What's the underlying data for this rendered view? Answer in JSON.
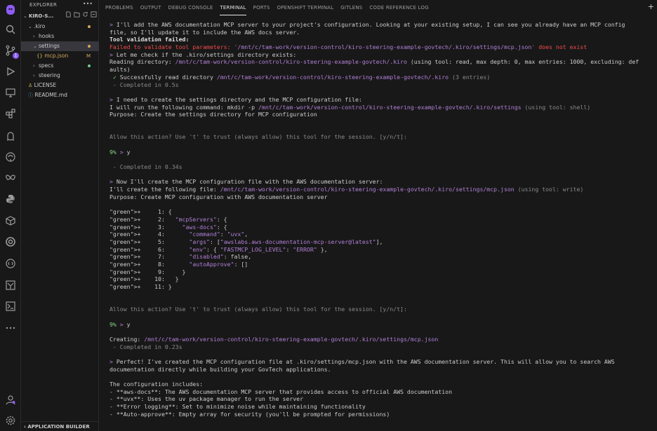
{
  "activity_bar": {
    "icons": [
      "kiro-logo-icon",
      "search-icon",
      "source-control-icon",
      "run-debug-icon",
      "remote-explorer-icon",
      "extensions-icon",
      "kiro-ghost-icon",
      "github-icon",
      "kiro-butterfly-icon",
      "python-icon",
      "containers-icon",
      "openshift-icon",
      "gitlens-icon",
      "chat-icon",
      "testing-icon",
      "more-icon",
      "account-icon",
      "settings-gear-icon"
    ],
    "badge": "1"
  },
  "explorer": {
    "header": "EXPLORER",
    "more": "•••",
    "project": "KIRO-S...",
    "items": [
      {
        "label": ".kiro",
        "indent": 1,
        "chevron": "v"
      },
      {
        "label": "hooks",
        "indent": 2,
        "chevron": ">"
      },
      {
        "label": "settings",
        "indent": 2,
        "chevron": "v"
      },
      {
        "label": "mcp.json",
        "indent": 3,
        "chevron": "{}",
        "flag": "M"
      },
      {
        "label": "specs",
        "indent": 2,
        "chevron": ">"
      },
      {
        "label": "steering",
        "indent": 2,
        "chevron": ">"
      },
      {
        "label": "LICENSE",
        "indent": 1,
        "chevron": ""
      },
      {
        "label": "README.md",
        "indent": 1,
        "chevron": ""
      }
    ],
    "footer": "APPLICATION BUILDER"
  },
  "panel": {
    "tabs": [
      "PROBLEMS",
      "OUTPUT",
      "DEBUG CONSOLE",
      "TERMINAL",
      "PORTS",
      "OPENSHIFT TERMINAL",
      "GITLENS",
      "CODE REFERENCE LOG"
    ],
    "active_tab": "TERMINAL",
    "plus": "+"
  },
  "terminal": {
    "lines": [
      "> I'll add the AWS documentation MCP server to your project's configuration. Looking at your existing setup, I can see you already have an MCP config",
      "file, so I'll update it to include the AWS docs server.",
      "Tool validation failed:",
      "Failed to validate tool parameters: '/mnt/c/tam-work/version-control/kiro-steering-example-govtech/.kiro/settings/mcp.json' does not exist",
      "> Let me check if the .kiro/settings directory exists:",
      "Reading directory: /mnt/c/tam-work/version-control/kiro-steering-example-govtech/.kiro (using tool: read, max depth: 0, max entries: 1000, excluding: def",
      "aults)",
      " ✓ Successfully read directory /mnt/c/tam-work/version-control/kiro-steering-example-govtech/.kiro (3 entries)",
      " - Completed in 0.5s",
      "",
      "> I need to create the settings directory and the MCP configuration file:",
      "I will run the following command: mkdir -p /mnt/c/tam-work/version-control/kiro-steering-example-govtech/.kiro/settings (using tool: shell)",
      "Purpose: Create the settings directory for MCP configuration",
      "",
      "",
      "Allow this action? Use 't' to trust (always allow) this tool for the session. [y/n/t]:",
      "",
      "9% > y",
      "",
      " - Completed in 0.34s",
      "",
      "> Now I'll create the MCP configuration file with the AWS documentation server:",
      "I'll create the following file: /mnt/c/tam-work/version-control/kiro-steering-example-govtech/.kiro/settings/mcp.json (using tool: write)",
      "Purpose: Create MCP configuration with AWS documentation server",
      "",
      "+     1: {",
      "+     2:   \"mcpServers\": {",
      "+     3:     \"aws-docs\": {",
      "+     4:       \"command\": \"uvx\",",
      "+     5:       \"args\": [\"awslabs.aws-documentation-mcp-server@latest\"],",
      "+     6:       \"env\": { \"FASTMCP_LOG_LEVEL\": \"ERROR\" },",
      "+     7:       \"disabled\": false,",
      "+     8:       \"autoApprove\": []",
      "+     9:     }",
      "+    10:   }",
      "+    11: }",
      "",
      "",
      "Allow this action? Use 't' to trust (always allow) this tool for the session. [y/n/t]:",
      "",
      "9% > y",
      "",
      "Creating: /mnt/c/tam-work/version-control/kiro-steering-example-govtech/.kiro/settings/mcp.json",
      " - Completed in 0.23s",
      "",
      "> Perfect! I've created the MCP configuration file at .kiro/settings/mcp.json with the AWS documentation server. This will allow you to search AWS",
      "documentation directly while building your GovTech applications.",
      "",
      "The configuration includes:",
      "- **aws-docs**: The AWS documentation MCP server that provides access to official AWS documentation",
      "- **uvx**: Uses the uv package manager to run the server",
      "- **Error logging**: Set to minimize noise while maintaining functionality",
      "- **Auto-approve**: Empty array for security (you'll be prompted for permissions)"
    ]
  }
}
